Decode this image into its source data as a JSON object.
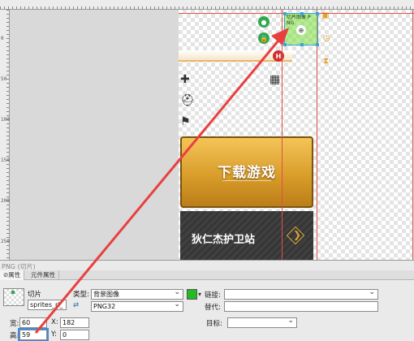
{
  "ruler": {
    "left_numbers": [
      "0",
      "50",
      "100",
      "150",
      "200",
      "250"
    ]
  },
  "canvas": {
    "download_banner_text": "下载游戏",
    "guard_banner_text": "狄仁杰护卫站",
    "arrow_glyph": "❯",
    "slice_label": "切片图像 P NG"
  },
  "panel": {
    "title": "PNG (切片)",
    "tabs": [
      {
        "label": "属性",
        "icon": "⊘"
      },
      {
        "label": "元件属性"
      }
    ],
    "slice_label": "切片",
    "slice_name": "sprites_rl_",
    "type_label": "类型:",
    "type_value": "背景图像",
    "format_value": "PNG32",
    "link_label": "链接:",
    "alt_label": "替代:",
    "target_label": "目标:",
    "link_value": "",
    "alt_value": "",
    "target_value": "",
    "w_label": "宽:",
    "w_value": "60",
    "h_label": "高:",
    "h_value": "59",
    "x_label": "X:",
    "x_value": "182",
    "y_label": "Y:",
    "y_value": "0"
  },
  "colors": {
    "swatch": "#22bb22",
    "arrow": "#e84040"
  },
  "icons": [
    "green-dot-icon",
    "lock-icon",
    "hot-badge-icon",
    "puzzle-icon",
    "helmet-icon",
    "flag-icon",
    "calendar-icon",
    "gift-icon",
    "clock-icon",
    "hourglass-icon"
  ]
}
